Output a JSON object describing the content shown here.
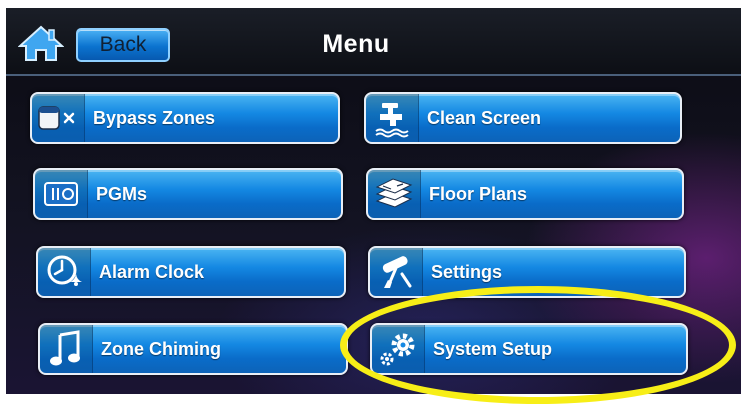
{
  "header": {
    "title": "Menu",
    "back_label": "Back",
    "home_icon": "home-icon"
  },
  "menu": {
    "items": [
      {
        "label": "Bypass Zones",
        "icon": "bypass-zones-icon"
      },
      {
        "label": "Clean Screen",
        "icon": "faucet-icon"
      },
      {
        "label": "PGMs",
        "icon": "pgm-switch-icon"
      },
      {
        "label": "Floor Plans",
        "icon": "floor-plans-icon"
      },
      {
        "label": "Alarm Clock",
        "icon": "alarm-clock-icon"
      },
      {
        "label": "Settings",
        "icon": "settings-tools-icon"
      },
      {
        "label": "Zone Chiming",
        "icon": "music-note-icon"
      },
      {
        "label": "System Setup",
        "icon": "gears-icon"
      }
    ]
  },
  "annotation": {
    "highlight_color": "#f7ee17",
    "highlighted_item": "System Setup"
  },
  "colors": {
    "button_blue": "#1488e3",
    "button_border": "#e8eef6",
    "background": "#0b0b12"
  }
}
